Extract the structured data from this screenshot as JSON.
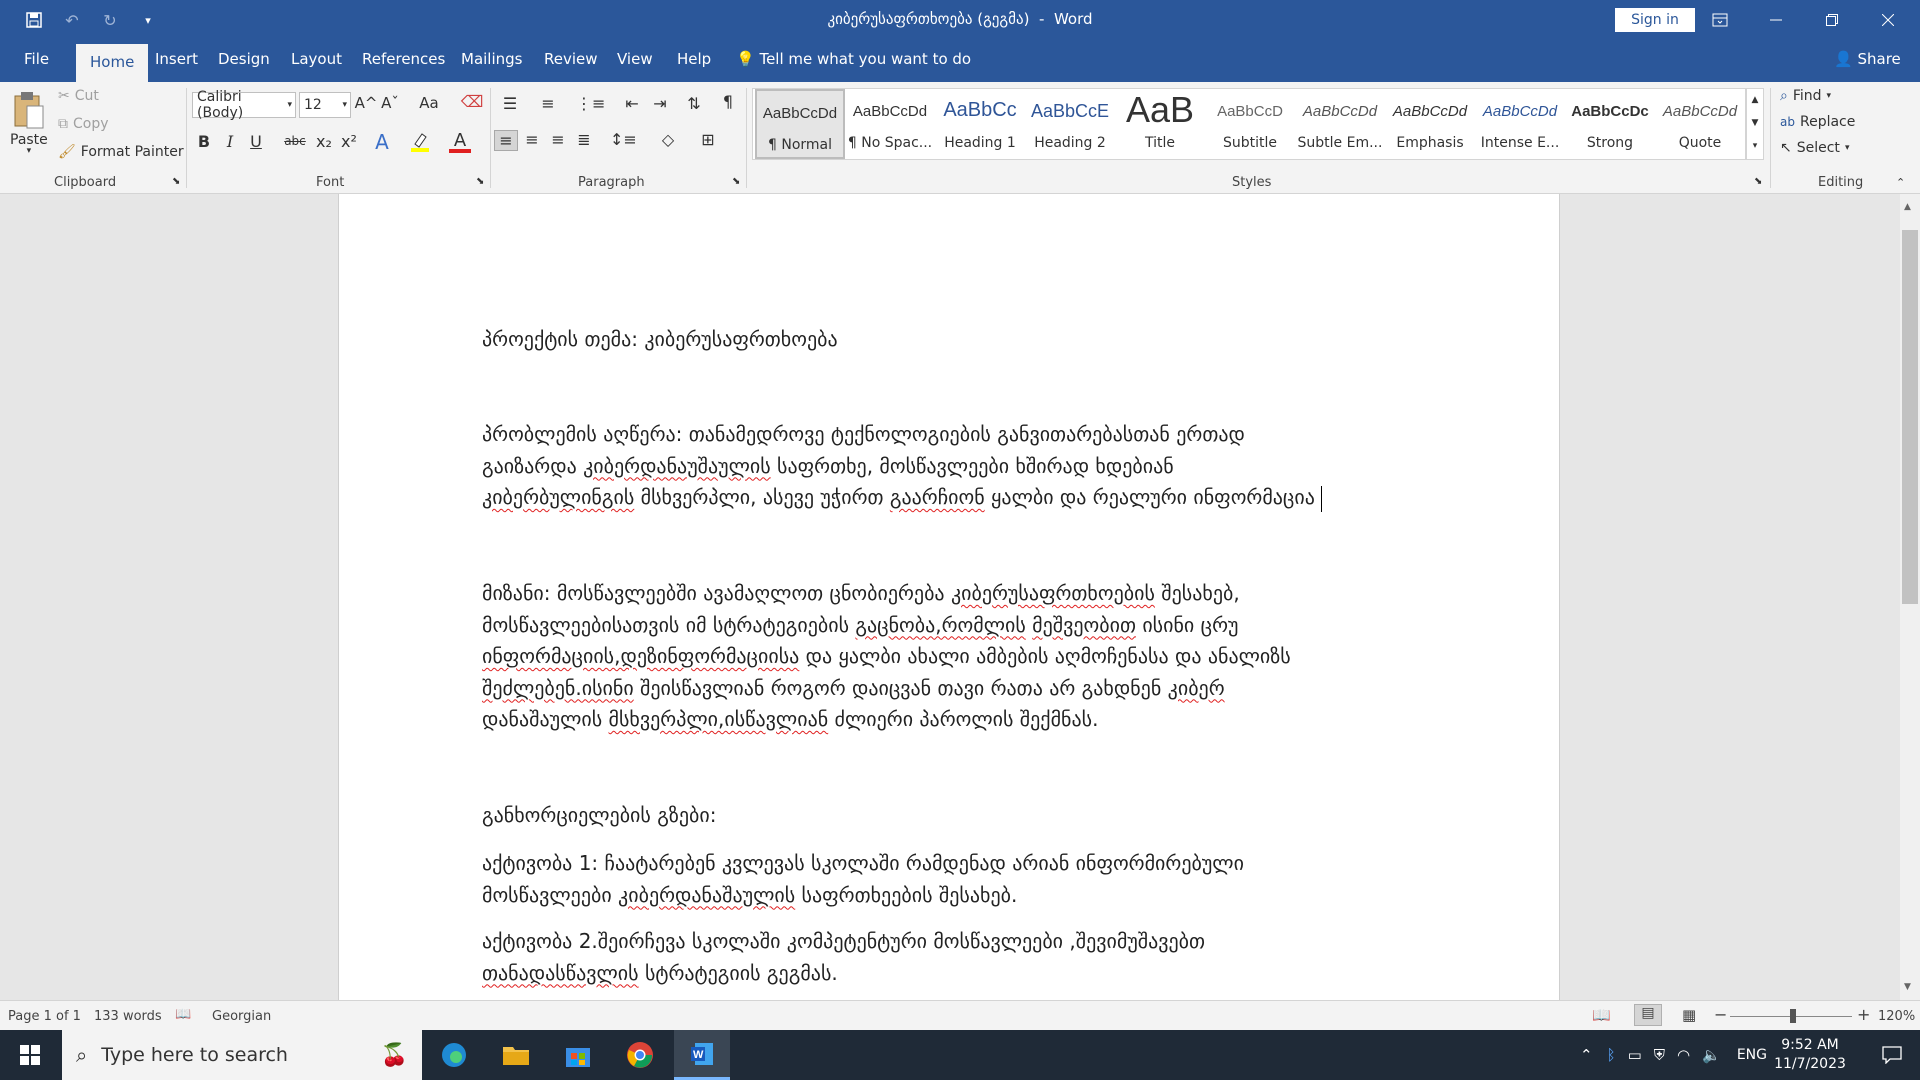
{
  "titlebar": {
    "doc_title": "კიბერუსაფრთხოება (გეგმა)",
    "separator": "-",
    "app_name": "Word",
    "sign_in": "Sign in",
    "save_icon": "save-icon",
    "undo_icon": "undo-icon",
    "redo_icon": "redo-icon",
    "customize_icon": "qat-dropdown-icon"
  },
  "tabs": [
    {
      "label": "File"
    },
    {
      "label": "Home"
    },
    {
      "label": "Insert"
    },
    {
      "label": "Design"
    },
    {
      "label": "Layout"
    },
    {
      "label": "References"
    },
    {
      "label": "Mailings"
    },
    {
      "label": "Review"
    },
    {
      "label": "View"
    },
    {
      "label": "Help"
    }
  ],
  "tell_me": "Tell me what you want to do",
  "share": "Share",
  "clipboard": {
    "paste": "Paste",
    "cut": "Cut",
    "copy": "Copy",
    "format_painter": "Format Painter",
    "group": "Clipboard"
  },
  "font": {
    "family": "Calibri (Body)",
    "size": "12",
    "group": "Font",
    "bold": "B",
    "italic": "I",
    "underline": "U",
    "strikethrough": "abc",
    "subscript": "x₂",
    "superscript": "x²",
    "grow": "A^",
    "shrink": "Aˇ",
    "change_case": "Aa",
    "text_effects": "A",
    "font_color": "A",
    "font_color_value": "#e02020",
    "highlight_color_value": "#ffff00"
  },
  "paragraph": {
    "group": "Paragraph",
    "pilcrow": "¶"
  },
  "styles": {
    "group": "Styles",
    "items": [
      {
        "sample": "AaBbCcDd",
        "name": "¶ Normal"
      },
      {
        "sample": "AaBbCcDd",
        "name": "¶ No Spac..."
      },
      {
        "sample": "AaBbCc",
        "name": "Heading 1"
      },
      {
        "sample": "AaBbCcE",
        "name": "Heading 2"
      },
      {
        "sample": "AaB",
        "name": "Title"
      },
      {
        "sample": "AaBbCcD",
        "name": "Subtitle"
      },
      {
        "sample": "AaBbCcDd",
        "name": "Subtle Em..."
      },
      {
        "sample": "AaBbCcDd",
        "name": "Emphasis"
      },
      {
        "sample": "AaBbCcDd",
        "name": "Intense E..."
      },
      {
        "sample": "AaBbCcDc",
        "name": "Strong"
      },
      {
        "sample": "AaBbCcDd",
        "name": "Quote"
      }
    ]
  },
  "editing": {
    "group": "Editing",
    "find": "Find",
    "replace": "Replace",
    "select": "Select"
  },
  "document": {
    "p1": "პროექტის თემა: კიბერუსაფრთხოება",
    "p2": {
      "line1": "პრობლემის აღწერა: თანამედროვე ტექნოლოგიების განვითარებასთან ერთად",
      "line2a": "გაიზარდა ",
      "line2b": "კიბერდანაუშაულის",
      "line2c": " საფრთხე, მოსწავლეები ხშირად ხდებიან",
      "line3a": "კიბერბულინგის",
      "line3b": " მსხვერპლი, ასევე უჭირთ ",
      "line3c": "გაარჩიონ",
      "line3d": " ყალბი და რეალური ინფორმაცია "
    },
    "p3": {
      "line1a": "მიზანი: მოსწავლეებში ავამაღლოთ ცნობიერება ",
      "line1b": "კიბერუსაფრთხოების",
      "line1c": " შესახებ,",
      "line2a": "მოსწავლეებისათვის იმ სტრატეგიების ",
      "line2b": "გაცნობა,რომლის",
      "line2c": " ",
      "line2d": "მეშვეობით",
      "line2e": " ისინი ცრუ",
      "line3a": "ინფორმაციის,დეზინფორმაციისა",
      "line3b": " და ყალბი ახალი ამბების აღმოჩენასა და ანალიზს",
      "line4a": "შეძლებენ.ისინი",
      "line4b": " შეისწავლიან როგორ დაიცვან თავი რათა არ გახდნენ ",
      "line4c": "კიბერ",
      "line5a": "დანაშაულის ",
      "line5b": "მსხვერპლი,ისწავლიან",
      "line5c": " ძლიერი პაროლის შექმნას."
    },
    "p4": "განხორციელების გზები:",
    "p5": {
      "line1": "აქტივობა 1: ჩაატარებენ კვლევას სკოლაში რამდენად არიან ინფორმირებული",
      "line2a": "მოსწავლეები ",
      "line2b": "კიბერდანაშაულის",
      "line2c": " საფრთხეების შესახებ."
    },
    "p6": {
      "line1": "აქტივობა 2.შეირჩევა სკოლაში კომპეტენტური მოსწავლეები ,შევიმუშავებთ",
      "line2a": "თანადასწავლის",
      "line2b": " სტრატეგიის გეგმას."
    }
  },
  "status": {
    "page": "Page 1 of 1",
    "words": "133 words",
    "language": "Georgian",
    "zoom": "120%",
    "zoom_minus": "−",
    "zoom_plus": "+"
  },
  "taskbar": {
    "search_placeholder": "Type here to search",
    "lang": "ENG",
    "time": "9:52 AM",
    "date": "11/7/2023"
  }
}
